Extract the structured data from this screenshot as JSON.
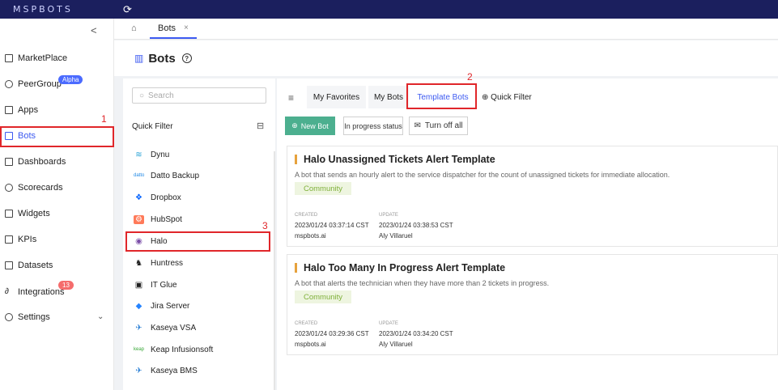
{
  "topbar": {
    "logo": "MSPBOTS",
    "sync_icon": "sync-icon"
  },
  "sidebar": {
    "items": [
      {
        "label": "MarketPlace",
        "icon": "grid-icon"
      },
      {
        "label": "PeerGroup",
        "icon": "people-icon",
        "badge": "Alpha"
      },
      {
        "label": "Apps",
        "icon": "apps-icon"
      },
      {
        "label": "Bots",
        "icon": "bot-icon",
        "active": true
      },
      {
        "label": "Dashboards",
        "icon": "dashboard-icon"
      },
      {
        "label": "Scorecards",
        "icon": "scorecard-icon"
      },
      {
        "label": "Widgets",
        "icon": "widget-icon"
      },
      {
        "label": "KPIs",
        "icon": "kpi-icon"
      },
      {
        "label": "Datasets",
        "icon": "dataset-icon"
      },
      {
        "label": "Integrations",
        "icon": "link-icon",
        "badge": "13"
      },
      {
        "label": "Settings",
        "icon": "gear-icon"
      }
    ]
  },
  "annotations": {
    "n1": "1",
    "n2": "2",
    "n3": "3"
  },
  "tabs": {
    "page_tab": "Bots",
    "close": "×"
  },
  "page": {
    "title": "Bots"
  },
  "filter_panel": {
    "search_placeholder": "Search",
    "quick_filter_title": "Quick Filter",
    "integrations": [
      {
        "label": "Dynu",
        "logo": "≋",
        "color": "#2aa3d6"
      },
      {
        "label": "Datto Backup",
        "logo": "datto",
        "color": "#1e88e5"
      },
      {
        "label": "Dropbox",
        "logo": "❖",
        "color": "#0061fe"
      },
      {
        "label": "HubSpot",
        "logo": "⚙",
        "color": "#ff7a59"
      },
      {
        "label": "Halo",
        "logo": "◉",
        "color": "#7b4ea8"
      },
      {
        "label": "Huntress",
        "logo": "♞",
        "color": "#222222"
      },
      {
        "label": "IT Glue",
        "logo": "▣",
        "color": "#222222"
      },
      {
        "label": "Jira Server",
        "logo": "◆",
        "color": "#2684ff"
      },
      {
        "label": "Kaseya VSA",
        "logo": "✈",
        "color": "#2a7fd4"
      },
      {
        "label": "Keap Infusionsoft",
        "logo": "keap",
        "color": "#36a635"
      },
      {
        "label": "Kaseya BMS",
        "logo": "✈",
        "color": "#2a7fd4"
      }
    ]
  },
  "bot_tabs": [
    {
      "label": "My Favorites"
    },
    {
      "label": "My Bots"
    },
    {
      "label": "Template Bots",
      "active": true
    }
  ],
  "quick_filter_label": "Quick Filter",
  "actions": {
    "new_bot": "New Bot",
    "in_progress": "In progress status",
    "turn_off": "Turn off all"
  },
  "cards": [
    {
      "title": "Halo Unassigned Tickets Alert Template",
      "description": "A bot that sends an hourly alert to the service dispatcher for the count of unassigned tickets for immediate allocation.",
      "tag": "Community",
      "created_label": "CREATED",
      "created_date": "2023/01/24 03:37:14 CST",
      "created_by": "mspbots.ai",
      "update_label": "UPDATE",
      "update_date": "2023/01/24 03:38:53 CST",
      "update_by": "Aly Villaruel"
    },
    {
      "title": "Halo Too Many In Progress Alert Template",
      "description": "A bot that alerts the technician when they have more than 2 tickets in progress.",
      "tag": "Community",
      "created_label": "CREATED",
      "created_date": "2023/01/24 03:29:36 CST",
      "created_by": "mspbots.ai",
      "update_label": "UPDATE",
      "update_date": "2023/01/24 03:34:20 CST",
      "update_by": "Aly Villaruel"
    }
  ]
}
